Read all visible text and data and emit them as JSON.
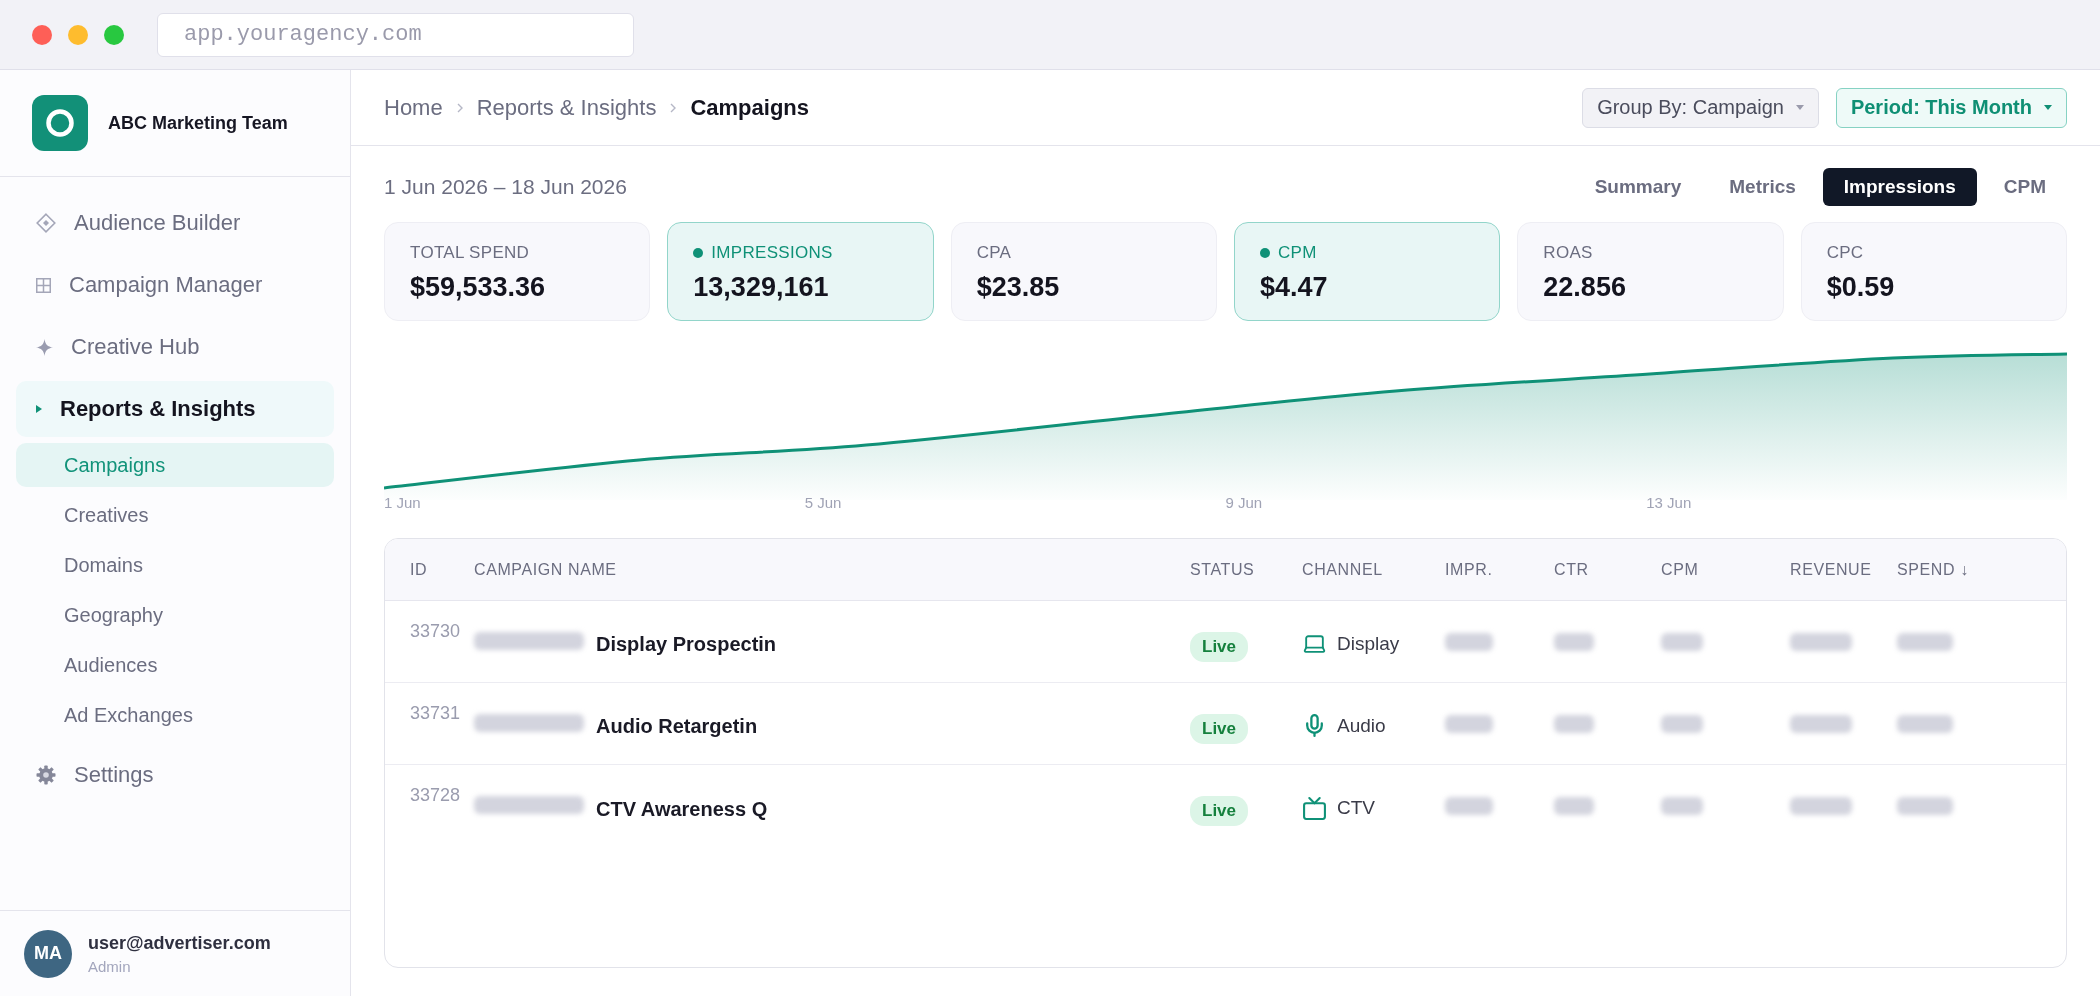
{
  "browser": {
    "address": "app.youragency.com"
  },
  "sidebar": {
    "team": "ABC Marketing Team",
    "nav": [
      {
        "label": "Audience Builder",
        "selected": false
      },
      {
        "label": "Campaign Manager",
        "selected": false
      },
      {
        "label": "Creative Hub",
        "selected": false
      },
      {
        "label": "Reports & Insights",
        "selected": true,
        "expanded": true,
        "children": [
          {
            "label": "Campaigns",
            "selected": true
          },
          {
            "label": "Creatives",
            "selected": false
          },
          {
            "label": "Domains",
            "selected": false
          },
          {
            "label": "Geography",
            "selected": false
          },
          {
            "label": "Audiences",
            "selected": false
          },
          {
            "label": "Ad Exchanges",
            "selected": false
          }
        ]
      },
      {
        "label": "Settings",
        "selected": false
      }
    ],
    "user": {
      "initials": "MA",
      "email": "user@advertiser.com",
      "role": "Admin"
    }
  },
  "header": {
    "breadcrumb": [
      {
        "label": "Home",
        "current": false
      },
      {
        "label": "Reports & Insights",
        "current": false
      },
      {
        "label": "Campaigns",
        "current": true
      }
    ],
    "dropdowns": [
      {
        "label": "Group By: Campaign",
        "active": false
      },
      {
        "label": "Period: This Month",
        "active": true
      }
    ]
  },
  "date_range": "1 Jun 2026 – 18 Jun 2026",
  "view_tabs": [
    {
      "label": "Summary",
      "selected": false
    },
    {
      "label": "Metrics",
      "selected": false
    },
    {
      "label": "Impressions",
      "selected": true
    },
    {
      "label": "CPM",
      "selected": false
    }
  ],
  "metrics": [
    {
      "label": "TOTAL SPEND",
      "value": "$59,533.36",
      "selected": false
    },
    {
      "label": "IMPRESSIONS",
      "value": "13,329,161",
      "selected": true
    },
    {
      "label": "CPA",
      "value": "$23.85",
      "selected": false
    },
    {
      "label": "CPM",
      "value": "$4.47",
      "selected": true
    },
    {
      "label": "ROAS",
      "value": "22.856",
      "selected": false
    },
    {
      "label": "CPC",
      "value": "$0.59",
      "selected": false
    }
  ],
  "chart": {
    "x_labels": [
      "1 Jun",
      "5 Jun",
      "9 Jun",
      "13 Jun"
    ]
  },
  "table": {
    "columns": [
      {
        "label": "ID",
        "kind": "id"
      },
      {
        "label": "CAMPAIGN NAME",
        "kind": "name"
      },
      {
        "label": "STATUS",
        "kind": "status"
      },
      {
        "label": "CHANNEL",
        "kind": "channel"
      },
      {
        "label": "IMPR.",
        "kind": "redacted"
      },
      {
        "label": "CTR",
        "kind": "redacted"
      },
      {
        "label": "CPM",
        "kind": "redacted"
      },
      {
        "label": "REVENUE",
        "kind": "redacted"
      },
      {
        "label": "SPEND ↓",
        "kind": "redacted"
      }
    ],
    "rows": [
      {
        "id": "33730",
        "name": "Display Prospectin",
        "status": "Live",
        "channel": {
          "kind": "display",
          "label": "Display"
        }
      },
      {
        "id": "33731",
        "name": "Audio Retargetin",
        "status": "Live",
        "channel": {
          "kind": "audio",
          "label": "Audio"
        }
      },
      {
        "id": "33728",
        "name": "CTV Awareness Q",
        "status": "Live",
        "channel": {
          "kind": "ctv",
          "label": "CTV"
        }
      }
    ]
  }
}
